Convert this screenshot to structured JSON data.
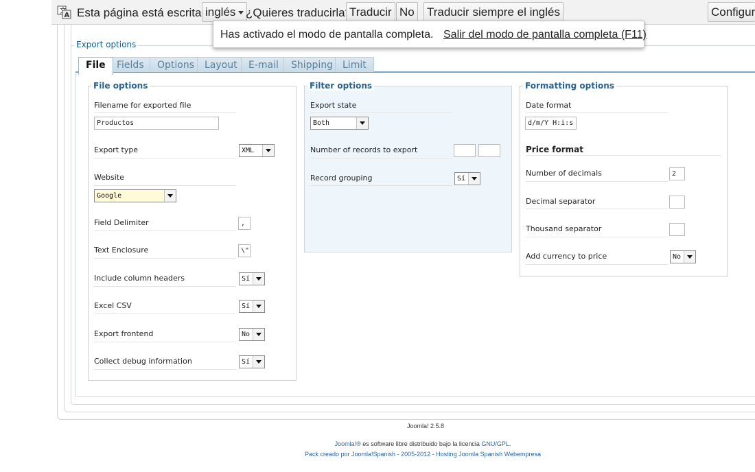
{
  "translate_bar": {
    "prefix": "Esta página está escrita en",
    "language": "inglés",
    "question": "¿Quieres traducirla?",
    "translate_btn": "Traducir",
    "no_btn": "No",
    "always_btn": "Traducir siempre el inglés",
    "configure_btn": "Configura"
  },
  "fullscreen": {
    "message": "Has activado el modo de pantalla completa.",
    "exit_link": "Salir del modo de pantalla completa (F11)"
  },
  "export_options_legend": "Export options",
  "tabs": [
    "File",
    "Fields",
    "Options",
    "Layout",
    "E-mail",
    "Shipping",
    "Limit"
  ],
  "file_options": {
    "legend": "File options",
    "filename_label": "Filename for exported file",
    "filename_value": "Productos",
    "export_type_label": "Export type",
    "export_type_value": "XML",
    "website_label": "Website",
    "website_value": "Google",
    "field_delimiter_label": "Field Delimiter",
    "field_delimiter_value": ",",
    "text_enclosure_label": "Text Enclosure",
    "text_enclosure_value": "\\\"",
    "include_headers_label": "Include column headers",
    "include_headers_value": "Sí",
    "excel_csv_label": "Excel CSV",
    "excel_csv_value": "Sí",
    "export_frontend_label": "Export frontend",
    "export_frontend_value": "No",
    "debug_label": "Collect debug information",
    "debug_value": "Sí"
  },
  "filter_options": {
    "legend": "Filter options",
    "export_state_label": "Export state",
    "export_state_value": "Both",
    "records_label": "Number of records to export",
    "record_grouping_label": "Record grouping",
    "record_grouping_value": "Sí"
  },
  "formatting_options": {
    "legend": "Formatting options",
    "date_format_label": "Date format",
    "date_format_value": "d/m/Y H:i:s",
    "price_format_heading": "Price format",
    "decimals_label": "Number of decimals",
    "decimals_value": "2",
    "decimal_sep_label": "Decimal separator",
    "thousand_sep_label": "Thousand separator",
    "currency_label": "Add currency to price",
    "currency_value": "No"
  },
  "footer": {
    "version": "Joomla! 2.5.8",
    "license_link": "Joomla!®",
    "license_text": " es software libre distribuido bajo la licencia ",
    "license_gpl": "GNU/GPL",
    "license_end": ".",
    "pack_text": "Pack creado por ",
    "pack_link1": "Joomla!Spanish",
    "pack_mid": " - 2005-2012 - ",
    "pack_link2": "Hosting Joomla Spanish Webempresa"
  }
}
